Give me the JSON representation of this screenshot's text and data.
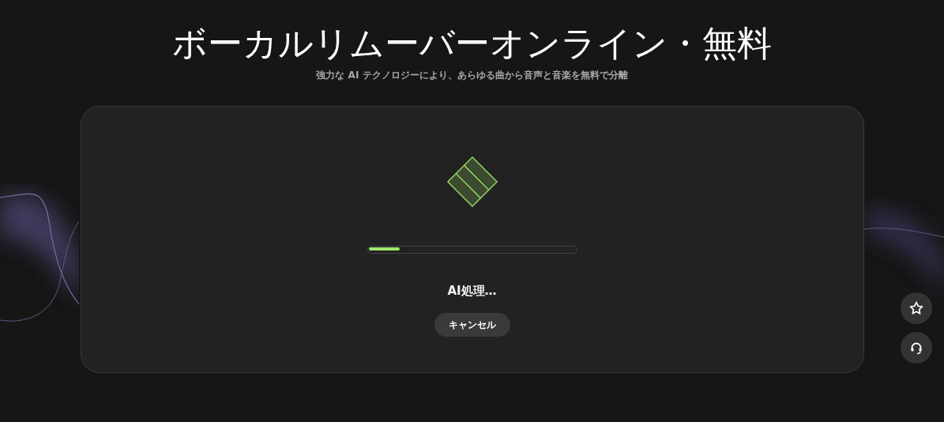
{
  "header": {
    "title": "ボーカルリムーバーオンライン・無料",
    "subtitle": "強力な AI テクノロジーにより、あらゆる曲から音声と音楽を無料で分離"
  },
  "processing": {
    "level": 0.15,
    "status": "AI処理…",
    "cancel_button": "キャンセル"
  },
  "floating_buttons": [
    {
      "kind": "star"
    },
    {
      "kind": "headset"
    }
  ]
}
